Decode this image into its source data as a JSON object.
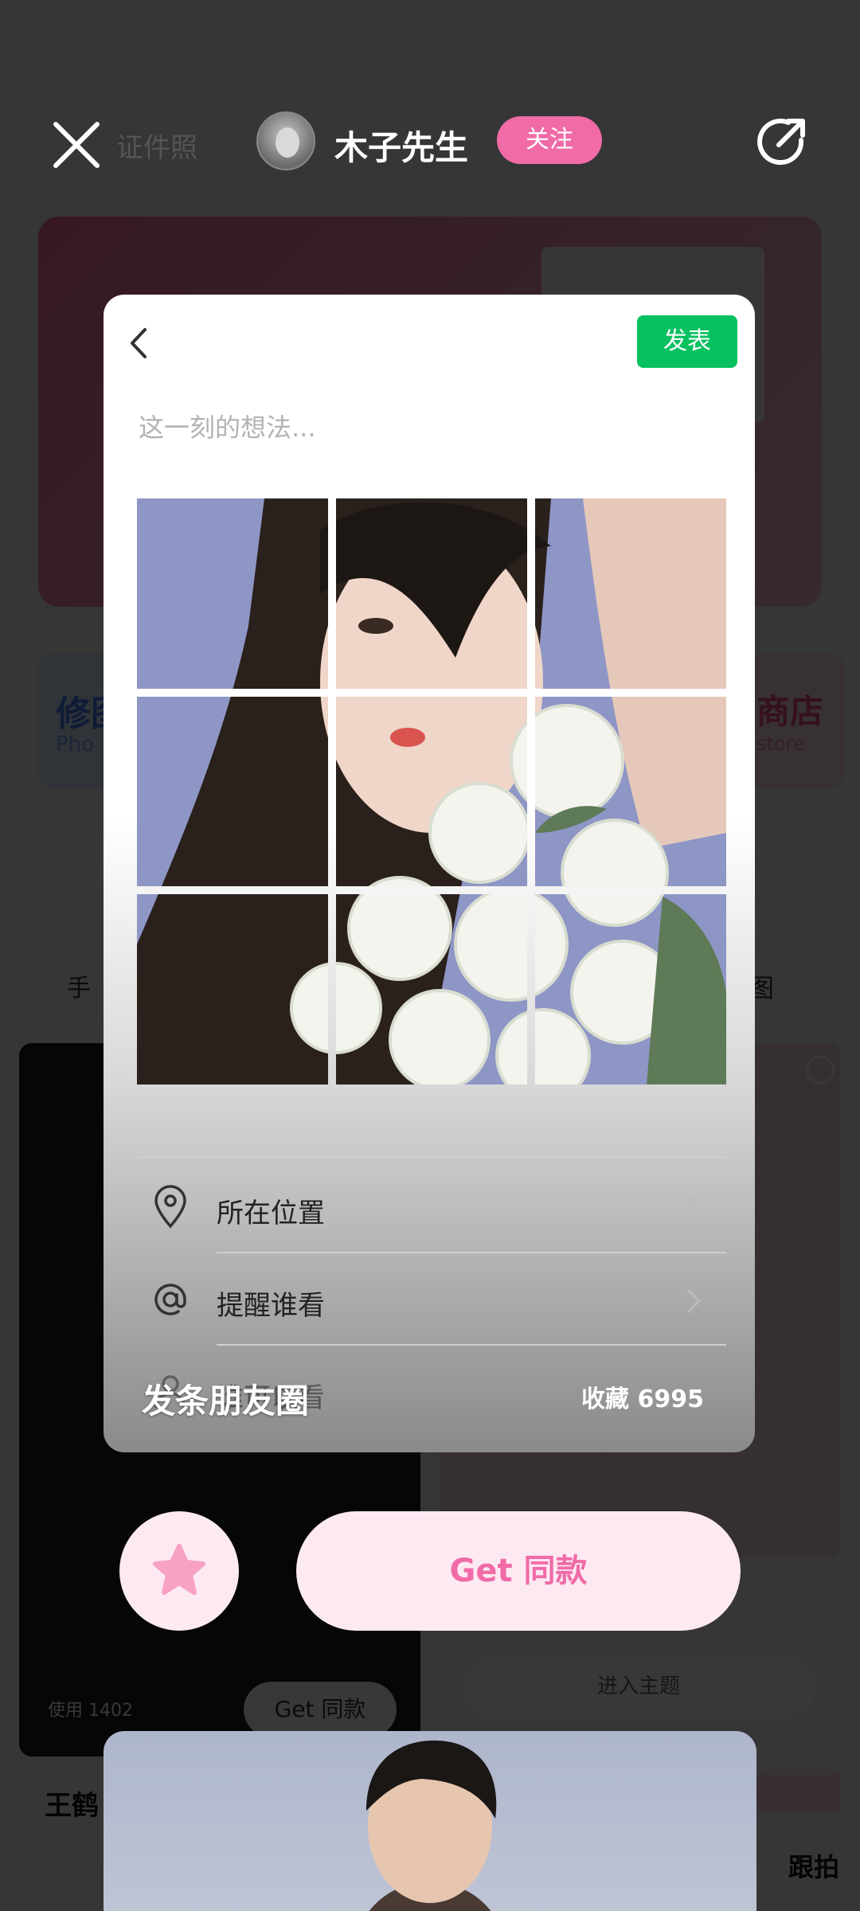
{
  "top_bar": {
    "category": "证件照",
    "author_name": "木子先生",
    "follow_label": "关注"
  },
  "background": {
    "card_left_title": "修图",
    "card_left_sub": "Pho",
    "card_right_title": "商店",
    "card_right_sub": "store",
    "row_left": "手",
    "row_right": "图",
    "use_count": "使用 1402",
    "get_same_small": "Get 同款",
    "enter_theme": "进入主题",
    "author_left": "王鹤",
    "follow_right": "跟拍"
  },
  "preview": {
    "publish_label": "发表",
    "placeholder": "这一刻的想法...",
    "options": [
      {
        "label": "所在位置",
        "icon": "location-pin-icon"
      },
      {
        "label": "提醒谁看",
        "icon": "at-sign-icon"
      },
      {
        "label": "谁可以看",
        "icon": "person-icon"
      }
    ],
    "caption": "发条朋友圈",
    "favorites": "收藏 6995"
  },
  "actions": {
    "favorite_icon": "star-icon",
    "get_same_label": "Get 同款"
  },
  "colors": {
    "accent_pink": "#f06ba7",
    "wechat_green": "#07c160",
    "button_bg": "#fde9f2"
  }
}
